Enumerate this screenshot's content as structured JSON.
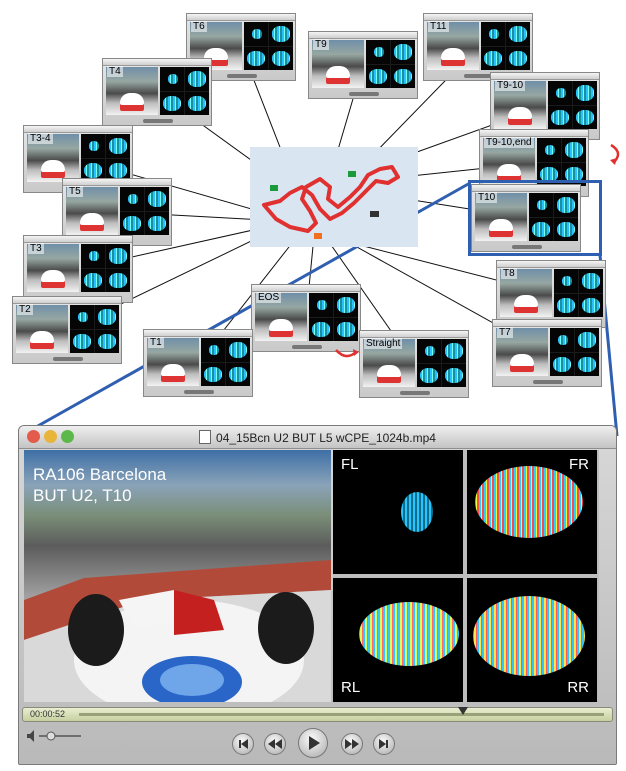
{
  "thumbnails": [
    {
      "id": "T6",
      "label": "T6"
    },
    {
      "id": "T9",
      "label": "T9"
    },
    {
      "id": "T11",
      "label": "T11"
    },
    {
      "id": "T4",
      "label": "T4"
    },
    {
      "id": "T9-10",
      "label": "T9-10"
    },
    {
      "id": "T3-4",
      "label": "T3-4"
    },
    {
      "id": "T9-10,end",
      "label": "T9-10,end"
    },
    {
      "id": "T5",
      "label": "T5"
    },
    {
      "id": "T10",
      "label": "T10"
    },
    {
      "id": "T3",
      "label": "T3"
    },
    {
      "id": "T8",
      "label": "T8"
    },
    {
      "id": "T2",
      "label": "T2"
    },
    {
      "id": "EOS",
      "label": "EOS"
    },
    {
      "id": "T1",
      "label": "T1"
    },
    {
      "id": "Straight",
      "label": "Straight"
    },
    {
      "id": "T7",
      "label": "T7"
    }
  ],
  "player": {
    "window_title": "04_15Bcn U2 BUT L5 wCPE_1024b.mp4",
    "overlay_line1": "RA106 Barcelona",
    "overlay_line2": "BUT U2, T10",
    "panel_labels": {
      "fl": "FL",
      "fr": "FR",
      "rl": "RL",
      "rr": "RR"
    },
    "time": "00:00:52",
    "progress": 0.72
  },
  "colors": {
    "highlight": "#2f5fb0",
    "track": "#e03030",
    "map_bg": "#d9e6f2",
    "arrow": "#e03030"
  }
}
